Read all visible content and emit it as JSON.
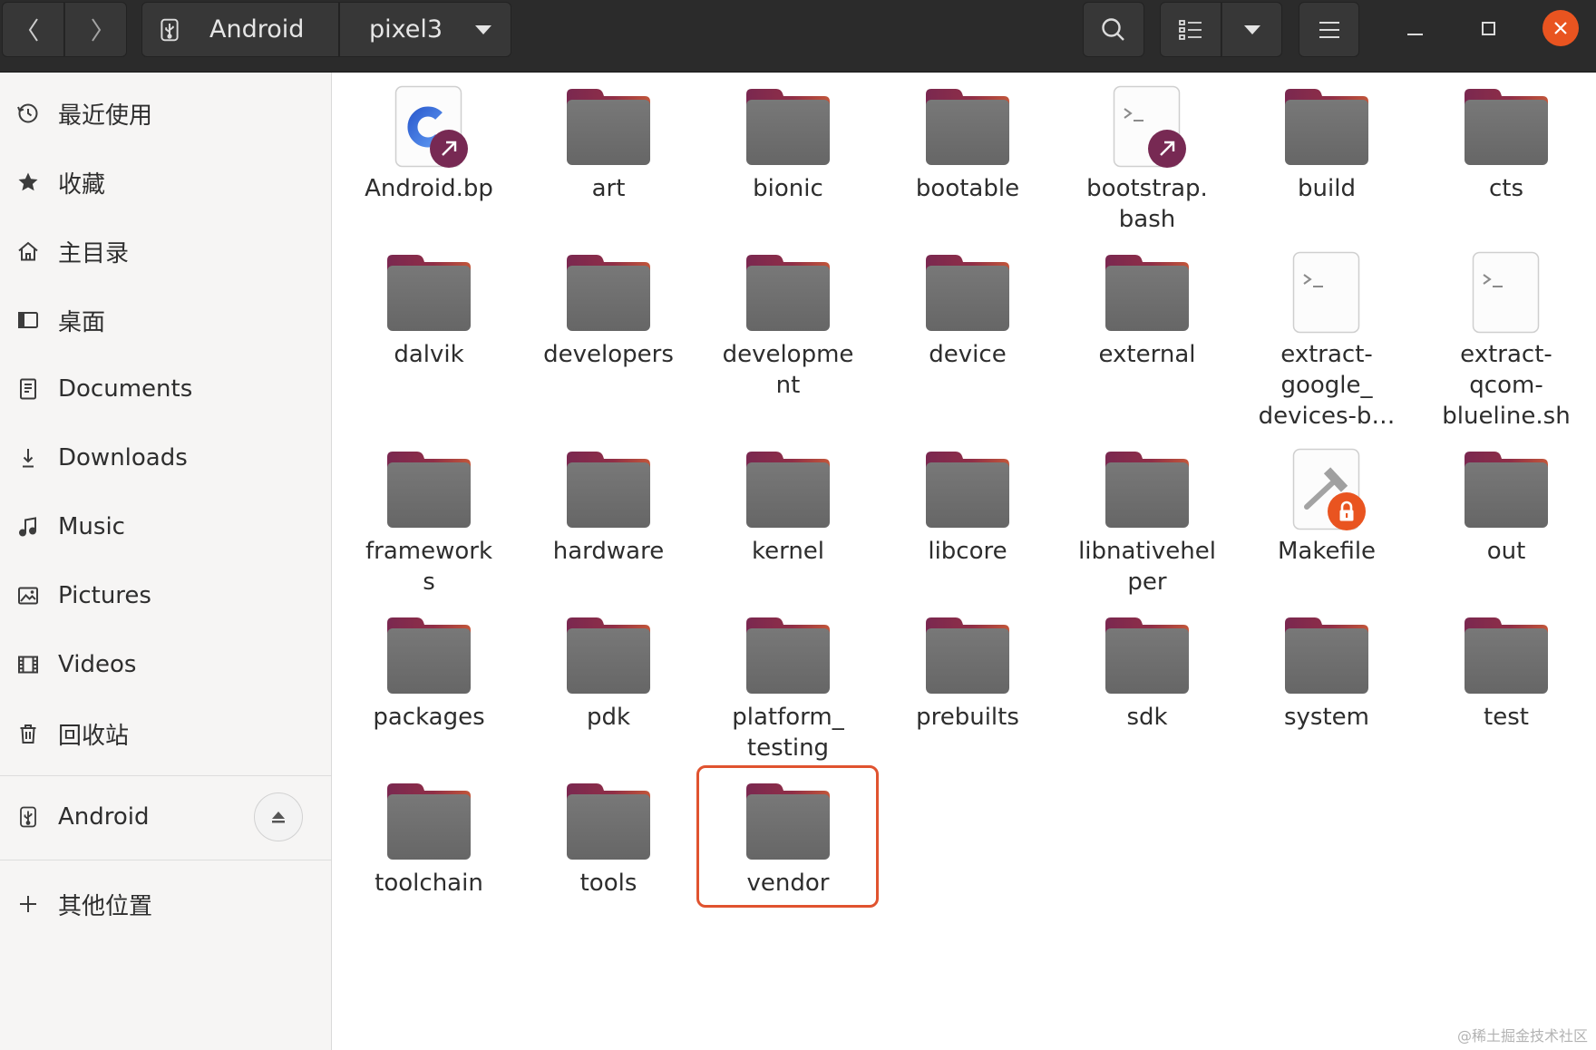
{
  "window": {
    "app": "Files",
    "window_controls": [
      "minimize-icon",
      "maximize-icon",
      "close-icon"
    ]
  },
  "header": {
    "nav_buttons": [
      "back-chevron-icon",
      "forward-chevron-icon"
    ],
    "path": {
      "device_icon": "usb-drive-icon",
      "segments": [
        "Android",
        "pixel3"
      ],
      "dropdown_icon": "dropdown-triangle-icon"
    },
    "tools": [
      "search-icon",
      "list-view-icon",
      "view-options-dropdown-icon",
      "menu-icon"
    ]
  },
  "sidebar": {
    "places": [
      {
        "label": "最近使用",
        "icon": "clock-icon"
      },
      {
        "label": "收藏",
        "icon": "star-icon"
      },
      {
        "label": "主目录",
        "icon": "home-icon"
      },
      {
        "label": "桌面",
        "icon": "desktop-icon"
      },
      {
        "label": "Documents",
        "icon": "documents-icon"
      },
      {
        "label": "Downloads",
        "icon": "downloads-icon"
      },
      {
        "label": "Music",
        "icon": "music-icon"
      },
      {
        "label": "Pictures",
        "icon": "pictures-icon"
      },
      {
        "label": "Videos",
        "icon": "videos-icon"
      },
      {
        "label": "回收站",
        "icon": "trash-icon"
      }
    ],
    "devices": [
      {
        "label": "Android",
        "icon": "usb-drive-icon",
        "action_icon": "eject-icon"
      }
    ],
    "other": {
      "label": "其他位置",
      "icon": "plus-icon"
    }
  },
  "files": [
    {
      "name": "Android.bp",
      "type": "file",
      "icon": "c-source-file-icon",
      "badge": "symlink-badge-icon"
    },
    {
      "name": "art",
      "type": "folder",
      "icon": "folder-icon"
    },
    {
      "name": "bionic",
      "type": "folder",
      "icon": "folder-icon"
    },
    {
      "name": "bootable",
      "type": "folder",
      "icon": "folder-icon"
    },
    {
      "name": "bootstrap.\nbash",
      "type": "file",
      "icon": "shell-script-icon",
      "badge": "symlink-badge-icon"
    },
    {
      "name": "build",
      "type": "folder",
      "icon": "folder-icon"
    },
    {
      "name": "cts",
      "type": "folder",
      "icon": "folder-icon"
    },
    {
      "name": "dalvik",
      "type": "folder",
      "icon": "folder-icon"
    },
    {
      "name": "developers",
      "type": "folder",
      "icon": "folder-icon"
    },
    {
      "name": "developme\nnt",
      "type": "folder",
      "icon": "folder-icon"
    },
    {
      "name": "device",
      "type": "folder",
      "icon": "folder-icon"
    },
    {
      "name": "external",
      "type": "folder",
      "icon": "folder-icon"
    },
    {
      "name": "extract-\ngoogle_\ndevices-b…",
      "type": "file",
      "icon": "shell-script-icon"
    },
    {
      "name": "extract-\nqcom-\nblueline.sh",
      "type": "file",
      "icon": "shell-script-icon"
    },
    {
      "name": "framework\ns",
      "type": "folder",
      "icon": "folder-icon"
    },
    {
      "name": "hardware",
      "type": "folder",
      "icon": "folder-icon"
    },
    {
      "name": "kernel",
      "type": "folder",
      "icon": "folder-icon"
    },
    {
      "name": "libcore",
      "type": "folder",
      "icon": "folder-icon"
    },
    {
      "name": "libnativehel\nper",
      "type": "folder",
      "icon": "folder-icon"
    },
    {
      "name": "Makefile",
      "type": "file",
      "icon": "makefile-icon",
      "badge": "lock-badge-icon"
    },
    {
      "name": "out",
      "type": "folder",
      "icon": "folder-icon"
    },
    {
      "name": "packages",
      "type": "folder",
      "icon": "folder-icon"
    },
    {
      "name": "pdk",
      "type": "folder",
      "icon": "folder-icon"
    },
    {
      "name": "platform_\ntesting",
      "type": "folder",
      "icon": "folder-icon"
    },
    {
      "name": "prebuilts",
      "type": "folder",
      "icon": "folder-icon"
    },
    {
      "name": "sdk",
      "type": "folder",
      "icon": "folder-icon"
    },
    {
      "name": "system",
      "type": "folder",
      "icon": "folder-icon"
    },
    {
      "name": "test",
      "type": "folder",
      "icon": "folder-icon"
    },
    {
      "name": "toolchain",
      "type": "folder",
      "icon": "folder-icon"
    },
    {
      "name": "tools",
      "type": "folder",
      "icon": "folder-icon"
    },
    {
      "name": "vendor",
      "type": "folder",
      "icon": "folder-icon",
      "highlighted": true
    }
  ],
  "colors": {
    "accent": "#e95420",
    "highlight_box": "#e0532f",
    "folder_tab": "#8a2d4a",
    "folder_body": "#6f6f6f",
    "symlink_badge": "#772953",
    "header_bg": "#2b2b2b",
    "sidebar_bg": "#f6f5f4"
  },
  "watermark": "@稀土掘金技术社区"
}
